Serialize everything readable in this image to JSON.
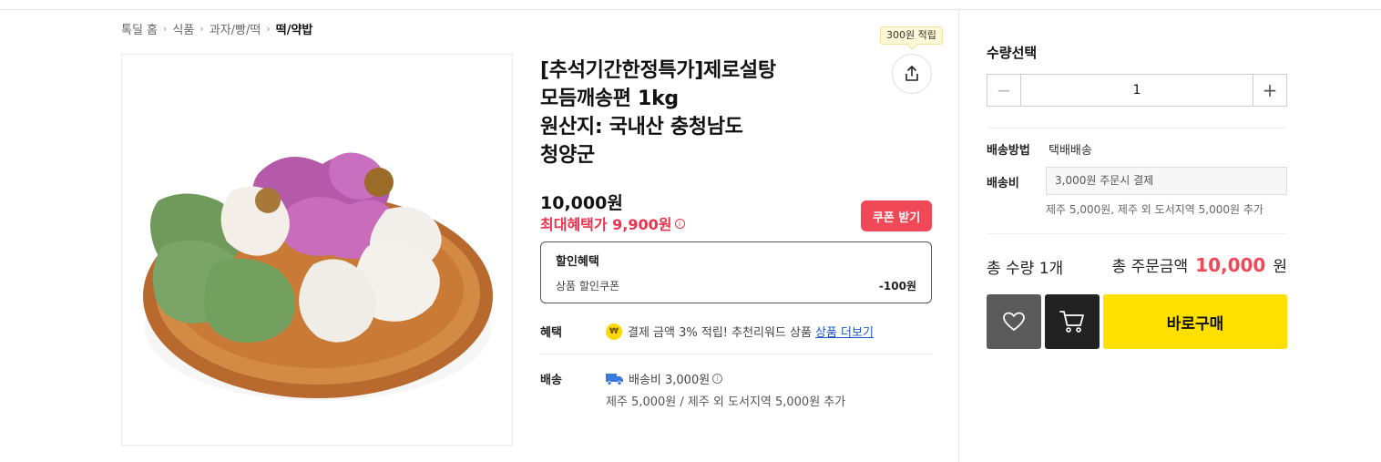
{
  "breadcrumb": {
    "items": [
      "톡딜 홈",
      "식품",
      "과자/빵/떡",
      "떡/약밥"
    ]
  },
  "product": {
    "title_lines": [
      "[추석기간한정특가]제로설탕",
      "모듬깨송편 1kg",
      "원산지: 국내산 충청남도",
      "청양군"
    ],
    "points_badge": "300원 적립",
    "price": "10,000원",
    "max_benefit": "최대혜택가 9,900원",
    "coupon_button": "쿠폰 받기",
    "discount": {
      "title": "할인혜택",
      "item_label": "상품 할인쿠폰",
      "item_value": "-100원"
    },
    "benefit": {
      "label": "혜택",
      "coin": "₩",
      "text": "결제 금액 3% 적립! 추천리워드 상품",
      "link": "상품 더보기"
    },
    "shipping": {
      "label": "배송",
      "fee_text": "배송비 3,000원",
      "sub_text": "제주 5,000원 / 제주 외 도서지역 5,000원 추가"
    }
  },
  "panel": {
    "qty_label": "수량선택",
    "qty_value": "1",
    "ship_method_label": "배송방법",
    "ship_method_value": "택배배송",
    "ship_fee_label": "배송비",
    "ship_fee_select": "3,000원 주문시 결제",
    "ship_fee_note": "제주 5,000원, 제주 외 도서지역 5,000원 추가",
    "total_qty": "총 수량 1개",
    "total_label": "총 주문금액",
    "total_amount": "10,000",
    "total_unit": "원",
    "buy_button": "바로구매"
  },
  "colors": {
    "accent_red": "#f04856",
    "buy_yellow": "#ffe000"
  },
  "icons": [
    "chevron-right-icon",
    "share-icon",
    "info-icon",
    "coin-icon",
    "truck-icon",
    "minus-icon",
    "plus-icon",
    "heart-icon",
    "cart-icon"
  ]
}
